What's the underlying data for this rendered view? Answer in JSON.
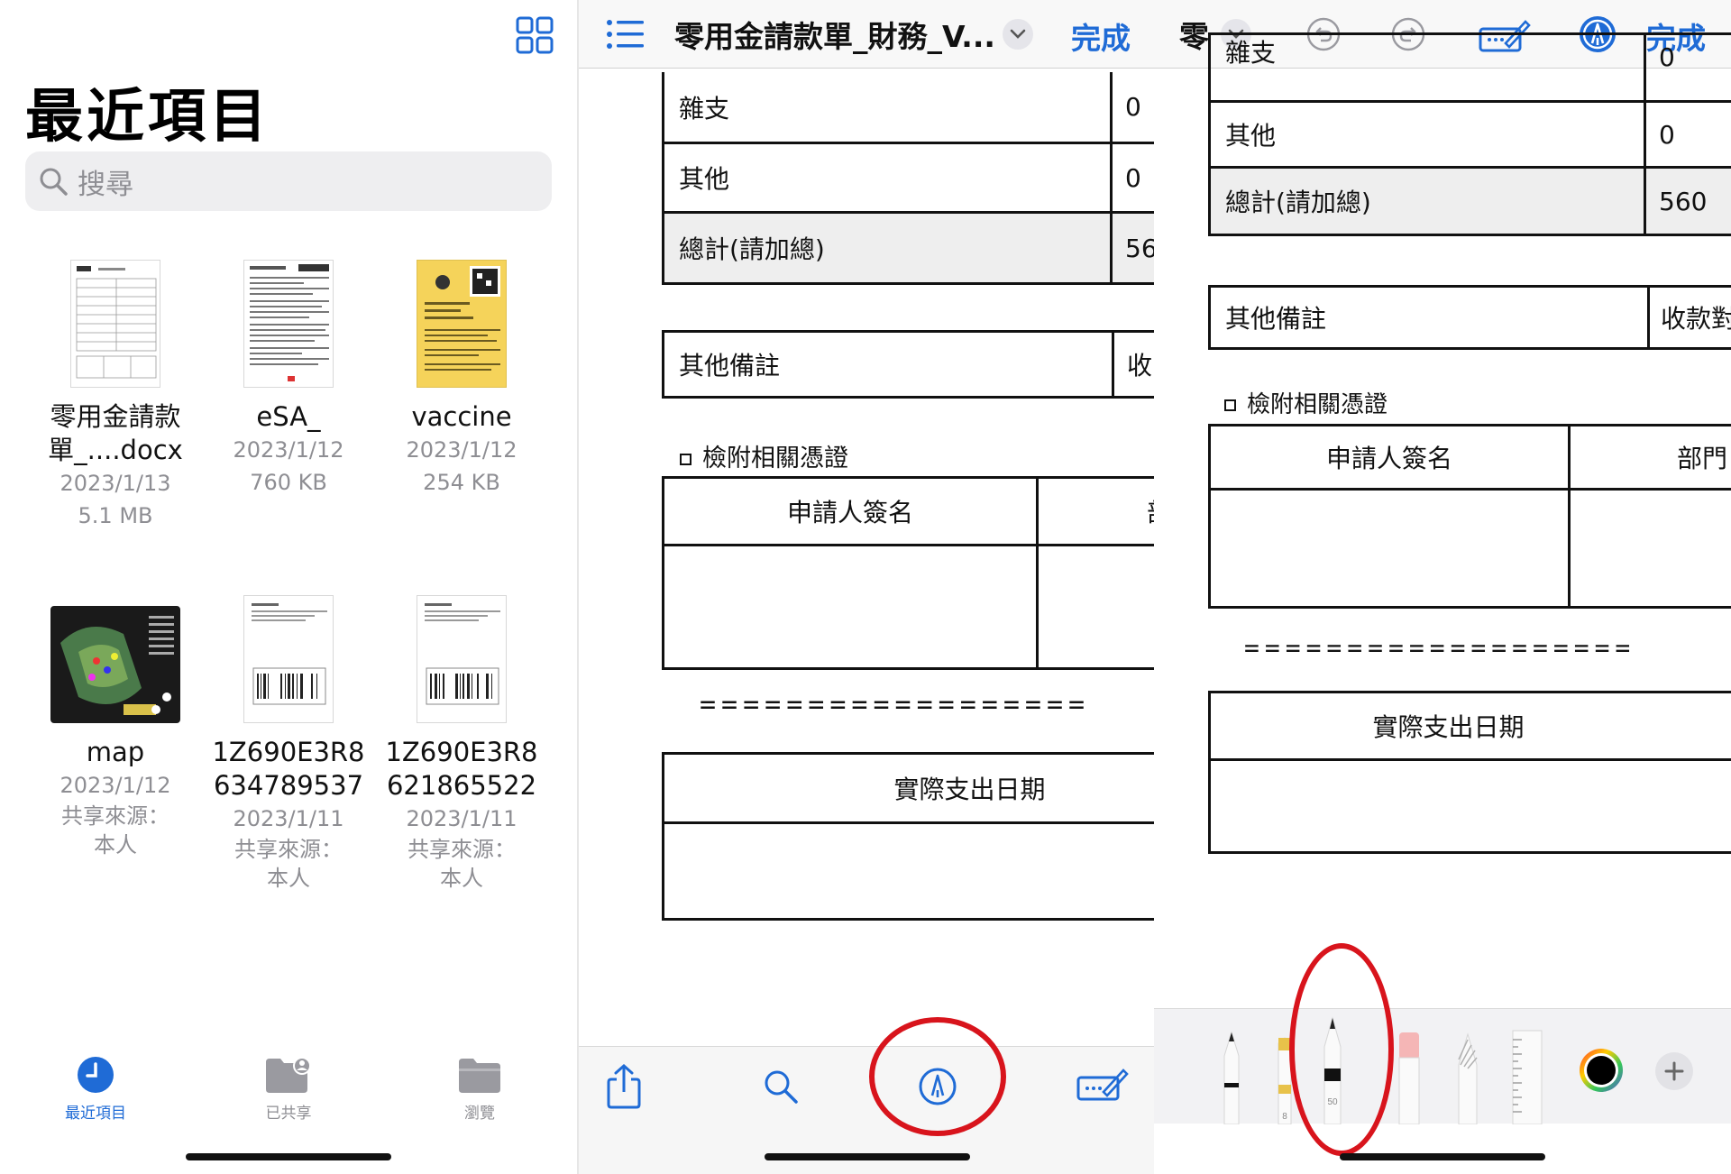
{
  "files_app": {
    "title": "最近項目",
    "search_placeholder": "搜尋",
    "files": [
      {
        "name_line1": "零用金請款",
        "name_line2": "單_....docx",
        "date": "2023/1/13",
        "size": "5.1 MB",
        "shared_line1": "",
        "shared_line2": ""
      },
      {
        "name_line1": "eSA_",
        "name_line2": "",
        "date": "2023/1/12",
        "size": "760 KB",
        "shared_line1": "",
        "shared_line2": ""
      },
      {
        "name_line1": "vaccine",
        "name_line2": "",
        "date": "2023/1/12",
        "size": "254 KB",
        "shared_line1": "",
        "shared_line2": ""
      },
      {
        "name_line1": "map",
        "name_line2": "",
        "date": "2023/1/12",
        "size": "",
        "shared_line1": "共享來源：",
        "shared_line2": "本人"
      },
      {
        "name_line1": "1Z690E3R8",
        "name_line2": "634789537",
        "date": "2023/1/11",
        "size": "",
        "shared_line1": "共享來源：",
        "shared_line2": "本人"
      },
      {
        "name_line1": "1Z690E3R8",
        "name_line2": "621865522",
        "date": "2023/1/11",
        "size": "",
        "shared_line1": "共享來源：",
        "shared_line2": "本人"
      }
    ],
    "tabs": [
      {
        "label": "最近項目",
        "icon": "clock-icon",
        "active": true
      },
      {
        "label": "已共享",
        "icon": "shared-folder-icon",
        "active": false
      },
      {
        "label": "瀏覽",
        "icon": "folder-icon",
        "active": false
      }
    ]
  },
  "viewer": {
    "doc_title": "零用金請款單_財務_V...",
    "done_label": "完成",
    "rows": {
      "misc_label": "雜支",
      "misc_value": "0",
      "other_label": "其他",
      "other_value": "0",
      "total_label": "總計(請加總)",
      "total_value": "560",
      "total_value_cut": "56",
      "remarks_label": "其他備註",
      "remarks_right_cut": "收"
    },
    "attach_label": "檢附相關憑證",
    "applicant_label": "申請人簽名",
    "applicant_right_cut": "部",
    "dashes": "==================",
    "actual_date_label": "實際支出日期",
    "bottom_icons": [
      "share-icon",
      "search-icon",
      "markup-icon",
      "edit-form-icon"
    ]
  },
  "markup": {
    "doc_title": "零",
    "done_label": "完成",
    "rows": {
      "misc_label": "雜支",
      "misc_value": "0",
      "other_label": "其他",
      "other_value": "0",
      "total_label": "總計(請加總)",
      "total_value": "560",
      "remarks_label": "其他備註",
      "remarks_right": "收款對"
    },
    "attach_label": "檢附相關憑證",
    "applicant_label": "申請人簽名",
    "dept_cut": "部門",
    "dashes": "===================",
    "actual_date_label": "實際支出日期",
    "pen_width_label": "50",
    "marker_width_label": "8",
    "tools": [
      "pen-icon",
      "marker-icon",
      "pencil-icon",
      "eraser-icon",
      "lasso-icon",
      "ruler-icon",
      "color-wheel-icon",
      "add-icon"
    ]
  },
  "colors": {
    "accent": "#1f6bd6",
    "annotation": "#d8141c"
  }
}
